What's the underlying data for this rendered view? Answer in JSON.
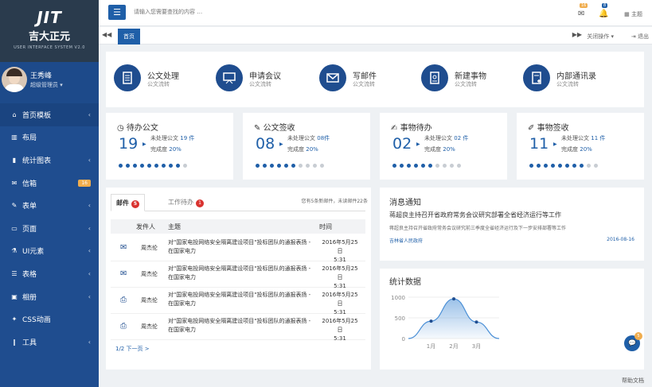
{
  "brand": {
    "mark": "JIT",
    "name_cn": "吉大正元",
    "name_en": "USER INTERFACE SYSTEM V2.0"
  },
  "user": {
    "name": "王秀峰",
    "role": "超级管理员"
  },
  "sidebar": {
    "items": [
      {
        "label": "首页模板",
        "icon": "home-icon",
        "glyph": "⌂",
        "arrow": true
      },
      {
        "label": "布局",
        "icon": "columns-icon",
        "glyph": "▥",
        "arrow": false
      },
      {
        "label": "统计图表",
        "icon": "bar-chart-icon",
        "glyph": "▮",
        "arrow": true
      },
      {
        "label": "信箱",
        "icon": "envelope-icon",
        "glyph": "✉",
        "badge": "16"
      },
      {
        "label": "表单",
        "icon": "edit-icon",
        "glyph": "✎",
        "arrow": true
      },
      {
        "label": "页面",
        "icon": "desktop-icon",
        "glyph": "▭",
        "arrow": true
      },
      {
        "label": "UI元素",
        "icon": "flask-icon",
        "glyph": "⚗",
        "arrow": true
      },
      {
        "label": "表格",
        "icon": "table-icon",
        "glyph": "☰",
        "arrow": true
      },
      {
        "label": "相册",
        "icon": "picture-icon",
        "glyph": "▣",
        "arrow": true
      },
      {
        "label": "CSS动画",
        "icon": "magic-icon",
        "glyph": "✦",
        "arrow": false
      },
      {
        "label": "工具",
        "icon": "cutlery-icon",
        "glyph": "‖",
        "arrow": true
      }
    ]
  },
  "topbar": {
    "search_placeholder": "请输入您需要查找的内容 …",
    "mail_badge": "16",
    "bell_badge": "8",
    "theme_label": "主题"
  },
  "tabs": {
    "active": "首页",
    "close_label": "关闭操作",
    "exit_label": "退出"
  },
  "quick": [
    {
      "title": "公文处理",
      "sub": "公文流转",
      "icon": "document-icon"
    },
    {
      "title": "申请会议",
      "sub": "公文流转",
      "icon": "presentation-icon"
    },
    {
      "title": "写邮件",
      "sub": "公文流转",
      "icon": "mail-icon"
    },
    {
      "title": "新建事物",
      "sub": "公文流转",
      "icon": "id-card-icon"
    },
    {
      "title": "内部通讯录",
      "sub": "公文流转",
      "icon": "contacts-icon"
    }
  ],
  "stats": [
    {
      "title": "待办公文",
      "icon": "clock-icon",
      "glyph": "◷",
      "number": "19",
      "line1": "未处理公文",
      "val1": "19 件",
      "line2": "完成度",
      "val2": "20%",
      "progress": 0.9
    },
    {
      "title": "公文签收",
      "icon": "pen-icon",
      "glyph": "✎",
      "number": "08",
      "line1": "未处理公文",
      "val1": "08件",
      "line2": "完成度",
      "val2": "20%",
      "progress": 0.6
    },
    {
      "title": "事物待办",
      "icon": "edit-doc-icon",
      "glyph": "✍",
      "number": "02",
      "line1": "未处理公文",
      "val1": "02 件",
      "line2": "完成度",
      "val2": "20%",
      "progress": 0.6
    },
    {
      "title": "事物签收",
      "icon": "pencil-icon",
      "glyph": "✐",
      "number": "11",
      "line1": "未处理公文",
      "val1": "11 件",
      "line2": "完成度",
      "val2": "20%",
      "progress": 0.8
    }
  ],
  "mail": {
    "tab_mail": "邮件",
    "tab_mail_count": "5",
    "tab_work": "工作待办",
    "tab_work_count": "1",
    "note": "您有5条新邮件，未读邮件22条",
    "headers": {
      "sender": "发件人",
      "subject": "主题",
      "time": "时间"
    },
    "rows": [
      {
        "icon": "envelope-icon",
        "glyph": "✉",
        "sender": "周杰伦",
        "subject": "对\"国家电投网络安全隔离建设项目\"投标团队的通报表扬 - 在国家电力",
        "date": "2016年5月25日",
        "time": "5:31"
      },
      {
        "icon": "envelope-icon",
        "glyph": "✉",
        "sender": "周杰伦",
        "subject": "对\"国家电投网络安全隔离建设项目\"投标团队的通报表扬 - 在国家电力",
        "date": "2016年5月25日",
        "time": "5:31"
      },
      {
        "icon": "open-envelope-icon",
        "glyph": "⎙",
        "sender": "周杰伦",
        "subject": "对\"国家电投网络安全隔离建设项目\"投标团队的通报表扬 - 在国家电力",
        "date": "2016年5月25日",
        "time": "5:31"
      },
      {
        "icon": "open-envelope-icon",
        "glyph": "⎙",
        "sender": "周杰伦",
        "subject": "对\"国家电投网络安全隔离建设项目\"投标团队的通报表扬 - 在国家电力",
        "date": "2016年5月25日",
        "time": "5:31"
      }
    ],
    "pager": "1/2 下一页 >"
  },
  "news": {
    "title": "消息通知",
    "headline": "蒋超良主持召开省政府常务会议研究部署全省经济运行等工作",
    "body": "蒋超良主持召开省政府常务会议研究前三季度全省经济运行及下一步安排部署等工作",
    "source": "吉林省人民政府",
    "date": "2016-08-16"
  },
  "chart_title": "统计数据",
  "chart_data": {
    "type": "area",
    "categories": [
      "1月",
      "2月",
      "3月"
    ],
    "x": [
      0,
      1,
      2,
      3,
      4
    ],
    "values": [
      0,
      420,
      960,
      400,
      0
    ],
    "ylim": [
      0,
      1000
    ],
    "yticks": [
      0,
      500,
      1000
    ],
    "markers": [
      1,
      2,
      3
    ],
    "color": "#4a8fd6"
  },
  "fab_badge": "5",
  "help_label": "帮助文档"
}
